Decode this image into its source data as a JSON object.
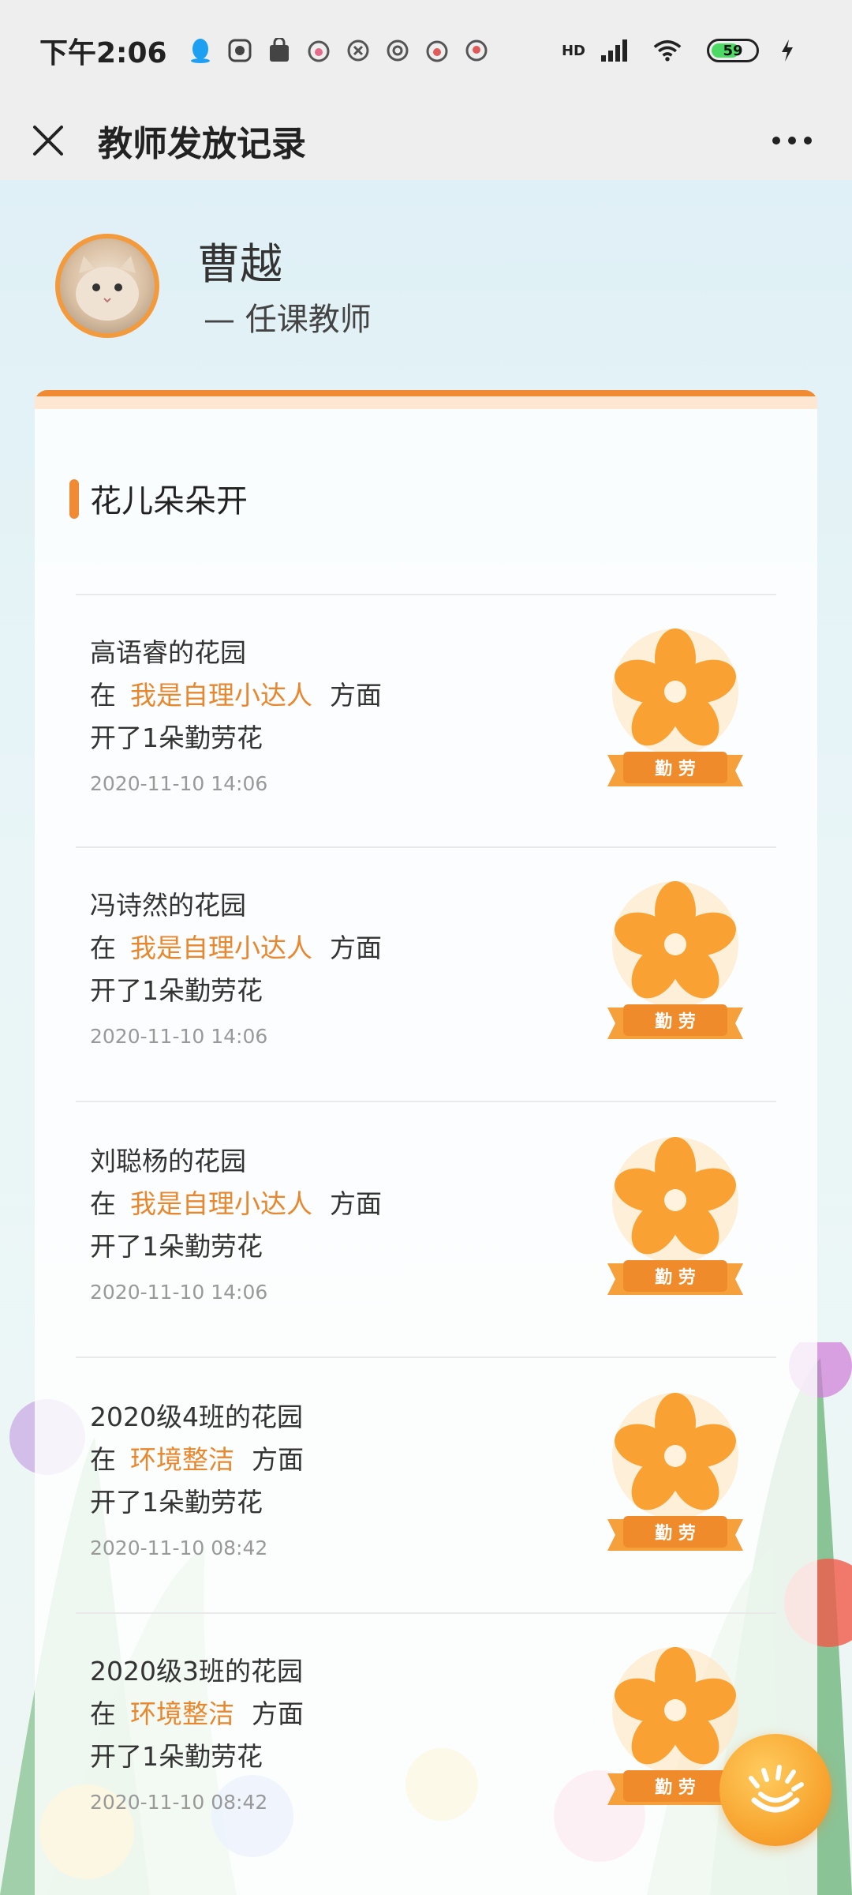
{
  "status_bar": {
    "time": "下午2:06",
    "network": "HD",
    "battery_level": "59",
    "icons": [
      "qq-icon",
      "app-icon",
      "bag-icon",
      "baby-icon",
      "app-icon",
      "app-icon",
      "baby-icon",
      "location-icon",
      "signal-icon",
      "wifi-icon",
      "battery-icon",
      "charging-icon"
    ]
  },
  "nav": {
    "title": "教师发放记录",
    "close_icon": "close-icon",
    "more_icon": "more-icon"
  },
  "profile": {
    "name": "曹越",
    "role": "— 任课教师"
  },
  "section": {
    "title": "花儿朵朵开"
  },
  "records": [
    {
      "garden": "高语睿的花园",
      "prefix": "在",
      "category": "我是自理小达人",
      "suffix": "方面",
      "result": "开了1朵勤劳花",
      "time": "2020-11-10 14:06",
      "badge_label": "勤 劳"
    },
    {
      "garden": "冯诗然的花园",
      "prefix": "在",
      "category": "我是自理小达人",
      "suffix": "方面",
      "result": "开了1朵勤劳花",
      "time": "2020-11-10 14:06",
      "badge_label": "勤 劳"
    },
    {
      "garden": "刘聪杨的花园",
      "prefix": "在",
      "category": "我是自理小达人",
      "suffix": "方面",
      "result": "开了1朵勤劳花",
      "time": "2020-11-10 14:06",
      "badge_label": "勤 劳"
    },
    {
      "garden": "2020级4班的花园",
      "prefix": "在",
      "category": "环境整洁",
      "suffix": "方面",
      "result": "开了1朵勤劳花",
      "time": "2020-11-10 08:42",
      "badge_label": "勤 劳"
    },
    {
      "garden": "2020级3班的花园",
      "prefix": "在",
      "category": "环境整洁",
      "suffix": "方面",
      "result": "开了1朵勤劳花",
      "time": "2020-11-10 08:42",
      "badge_label": "勤 劳"
    }
  ],
  "colors": {
    "accent": "#f08b34",
    "category_text": "#e8872d",
    "nav_bg": "#eeeeee"
  }
}
